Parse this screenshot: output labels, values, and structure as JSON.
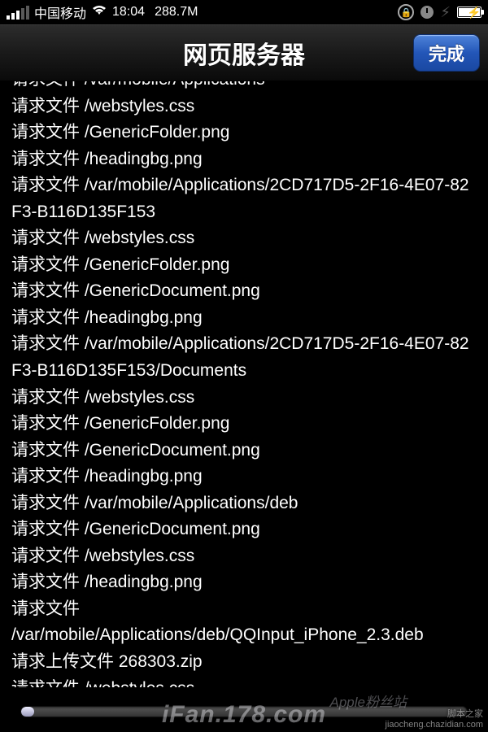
{
  "status": {
    "carrier": "中国移动",
    "time": "18:04",
    "memory": "288.7M"
  },
  "nav": {
    "title": "网页服务器",
    "done_label": "完成"
  },
  "log": {
    "req_prefix": "请求文件 ",
    "upload_prefix": "请求上传文件 ",
    "lines": [
      {
        "t": "req",
        "p": "/var/mobile/Applications",
        "cut": true
      },
      {
        "t": "req",
        "p": "/webstyles.css"
      },
      {
        "t": "req",
        "p": "/GenericFolder.png"
      },
      {
        "t": "req",
        "p": "/headingbg.png"
      },
      {
        "t": "req",
        "p": "/var/mobile/Applications/2CD717D5-2F16-4E07-82F3-B116D135F153"
      },
      {
        "t": "req",
        "p": "/webstyles.css"
      },
      {
        "t": "req",
        "p": "/GenericFolder.png"
      },
      {
        "t": "req",
        "p": "/GenericDocument.png"
      },
      {
        "t": "req",
        "p": "/headingbg.png"
      },
      {
        "t": "req",
        "p": "/var/mobile/Applications/2CD717D5-2F16-4E07-82F3-B116D135F153/Documents"
      },
      {
        "t": "req",
        "p": "/webstyles.css"
      },
      {
        "t": "req",
        "p": "/GenericFolder.png"
      },
      {
        "t": "req",
        "p": "/GenericDocument.png"
      },
      {
        "t": "req",
        "p": "/headingbg.png"
      },
      {
        "t": "req",
        "p": "/var/mobile/Applications/deb"
      },
      {
        "t": "req",
        "p": "/GenericDocument.png"
      },
      {
        "t": "req",
        "p": "/webstyles.css"
      },
      {
        "t": "req",
        "p": "/headingbg.png"
      },
      {
        "t": "req",
        "p": "/var/mobile/Applications/deb/QQInput_iPhone_2.3.deb",
        "break": true
      },
      {
        "t": "upload",
        "p": "268303.zip"
      },
      {
        "t": "req",
        "p": "/webstyles.css"
      }
    ]
  },
  "watermarks": {
    "w1": "Apple粉丝站",
    "w2": "iFan.178.com",
    "w3a": "脚本之家",
    "w3b": "jiaocheng.chazidian.com"
  }
}
